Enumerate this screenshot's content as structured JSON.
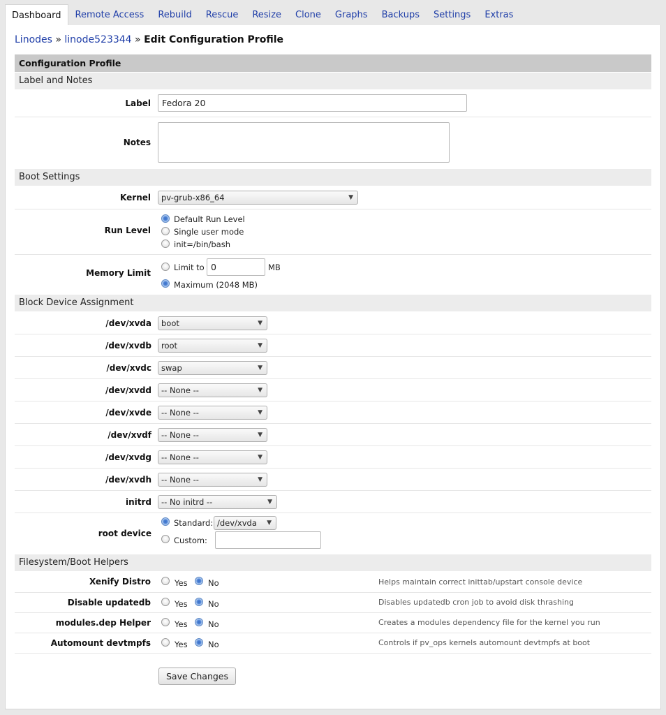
{
  "tabs": [
    "Dashboard",
    "Remote Access",
    "Rebuild",
    "Rescue",
    "Resize",
    "Clone",
    "Graphs",
    "Backups",
    "Settings",
    "Extras"
  ],
  "breadcrumb": {
    "root": "Linodes",
    "sep1": "»",
    "linode": "linode523344",
    "sep2": "»",
    "current": "Edit Configuration Profile"
  },
  "profile": {
    "title": "Configuration Profile",
    "label_section": "Label and Notes",
    "label_label": "Label",
    "label_value": "Fedora 20",
    "notes_label": "Notes",
    "notes_value": ""
  },
  "boot": {
    "section": "Boot Settings",
    "kernel_label": "Kernel",
    "kernel_value": "pv-grub-x86_64",
    "runlevel_label": "Run Level",
    "runlevel_options": [
      "Default Run Level",
      "Single user mode",
      "init=/bin/bash"
    ],
    "runlevel_selected": 0,
    "memory_label": "Memory Limit",
    "memory_limit_to": "Limit to",
    "memory_limit_value": "0",
    "memory_unit": "MB",
    "memory_maximum": "Maximum (2048 MB)"
  },
  "block": {
    "section": "Block Device Assignment",
    "devices": [
      {
        "name": "/dev/xvda",
        "value": "boot"
      },
      {
        "name": "/dev/xvdb",
        "value": "root"
      },
      {
        "name": "/dev/xvdc",
        "value": "swap"
      },
      {
        "name": "/dev/xvdd",
        "value": "-- None --"
      },
      {
        "name": "/dev/xvde",
        "value": "-- None --"
      },
      {
        "name": "/dev/xvdf",
        "value": "-- None --"
      },
      {
        "name": "/dev/xvdg",
        "value": "-- None --"
      },
      {
        "name": "/dev/xvdh",
        "value": "-- None --"
      }
    ],
    "initrd_label": "initrd",
    "initrd_value": "-- No initrd --",
    "rootdev_label": "root device",
    "standard_label": "Standard:",
    "standard_value": "/dev/xvda",
    "custom_label": "Custom:",
    "custom_value": ""
  },
  "helpers": {
    "section": "Filesystem/Boot Helpers",
    "yes": "Yes",
    "no": "No",
    "items": [
      {
        "label": "Xenify Distro",
        "help": "Helps maintain correct inittab/upstart console device"
      },
      {
        "label": "Disable updatedb",
        "help": "Disables updatedb cron job to avoid disk thrashing"
      },
      {
        "label": "modules.dep Helper",
        "help": "Creates a modules dependency file for the kernel you run"
      },
      {
        "label": "Automount devtmpfs",
        "help": "Controls if pv_ops kernels automount devtmpfs at boot"
      }
    ]
  },
  "save_label": "Save Changes",
  "colors": {
    "link": "#1f3ea8",
    "section_header": "#c9c9c9",
    "section_sub": "#ececec"
  }
}
